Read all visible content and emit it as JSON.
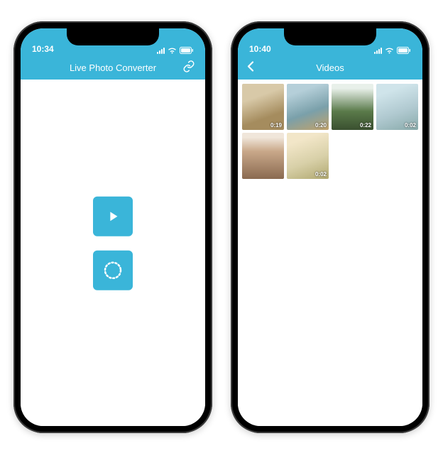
{
  "accent": "#3AB5D9",
  "left": {
    "status_time": "10:34",
    "title": "Live Photo Converter",
    "buttons": {
      "play": "play",
      "live": "live-photo"
    }
  },
  "right": {
    "status_time": "10:40",
    "title": "Videos",
    "thumbs": [
      {
        "duration": "0:19"
      },
      {
        "duration": "0:20"
      },
      {
        "duration": "0:22"
      },
      {
        "duration": "0:02"
      },
      {
        "duration": ""
      },
      {
        "duration": "0:02"
      }
    ]
  }
}
